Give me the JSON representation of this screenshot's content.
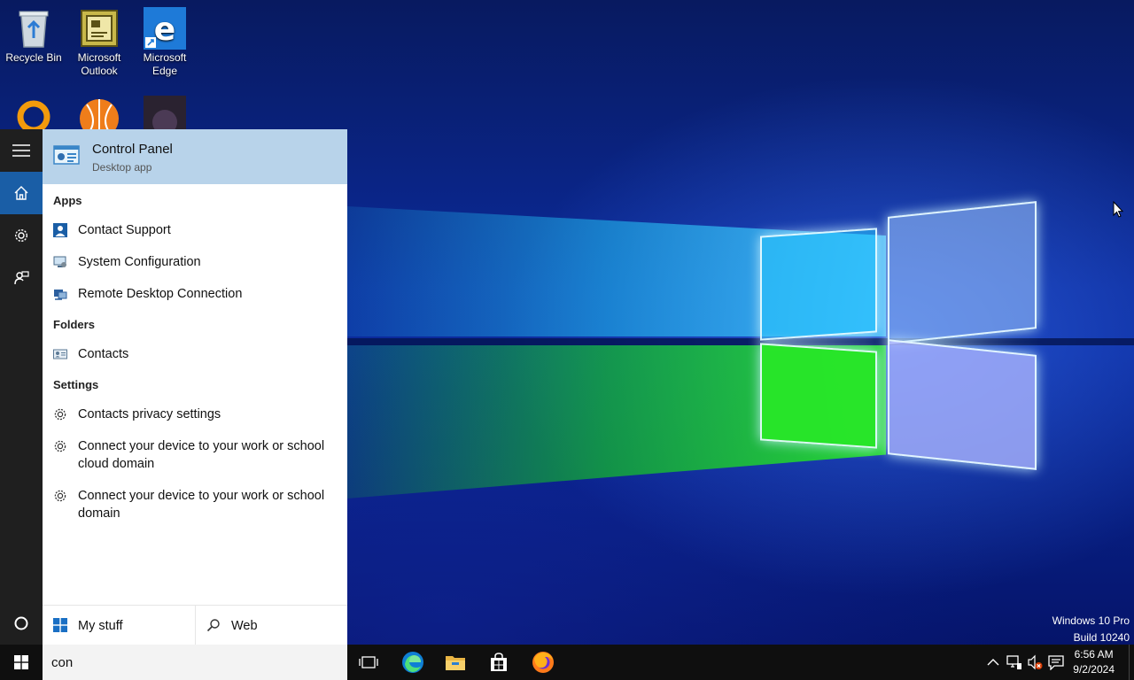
{
  "desktop": {
    "icons": [
      {
        "label": "Recycle Bin"
      },
      {
        "label": "Microsoft Outlook"
      },
      {
        "label": "Microsoft Edge"
      }
    ],
    "watermark": {
      "line1": "Windows 10 Pro",
      "line2": "Build 10240"
    }
  },
  "start_menu": {
    "best_match": {
      "title": "Control Panel",
      "subtitle": "Desktop app"
    },
    "sections": {
      "apps": "Apps",
      "folders": "Folders",
      "settings": "Settings"
    },
    "apps": [
      "Contact Support",
      "System Configuration",
      "Remote Desktop Connection"
    ],
    "folders": [
      "Contacts"
    ],
    "settings": [
      "Contacts privacy settings",
      "Connect your device to your work or school cloud domain",
      "Connect your device to your work or school domain"
    ],
    "bottom_tabs": {
      "my_stuff": "My stuff",
      "web": "Web"
    }
  },
  "taskbar": {
    "search_value": "con",
    "clock": {
      "time": "6:56 AM",
      "date": "9/2/2024"
    }
  },
  "colors": {
    "highlight": "#b8d3ea",
    "rail_active": "#1a5ea6",
    "taskbar": "#0f0f0f"
  }
}
